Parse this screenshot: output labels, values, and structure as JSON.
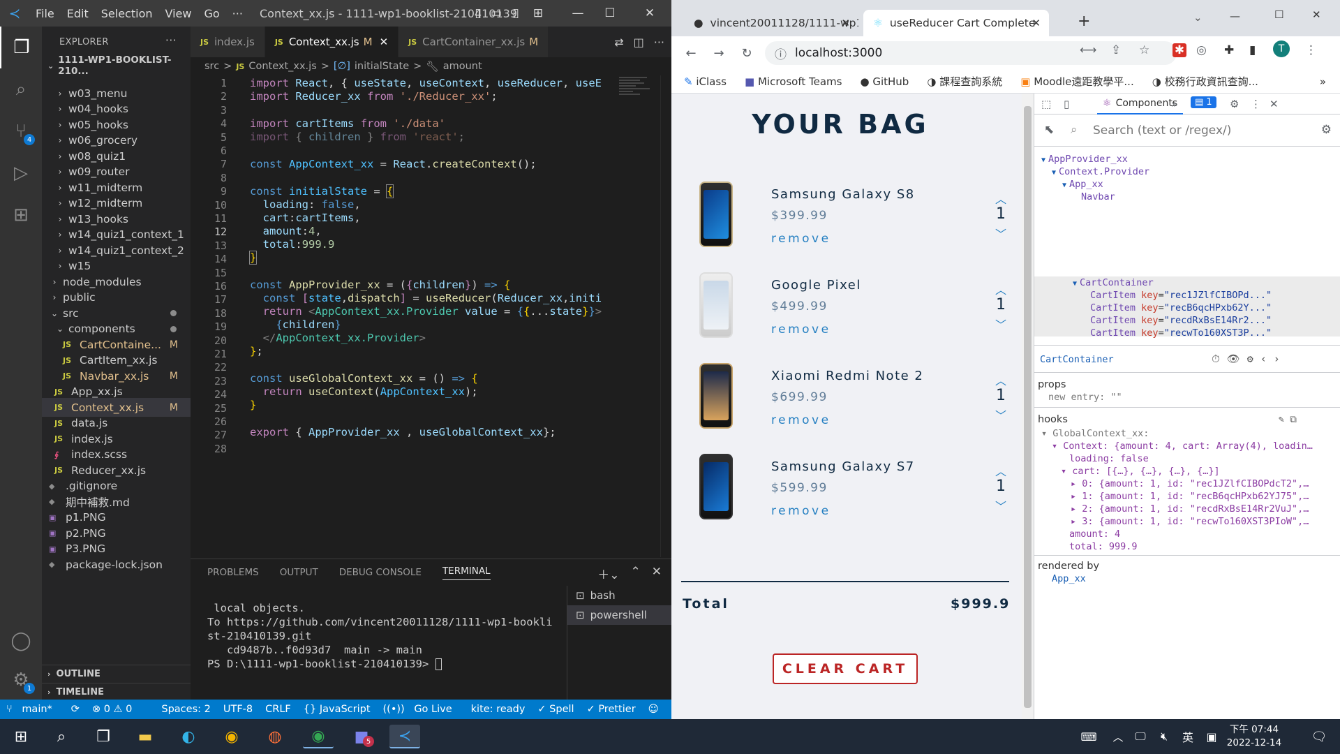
{
  "vscode": {
    "menu": [
      "File",
      "Edit",
      "Selection",
      "View",
      "Go",
      "···"
    ],
    "title": "Context_xx.js - 1111-wp1-booklist-210410139",
    "explorer_label": "EXPLORER",
    "root_folder": "1111-WP1-BOOKLIST-210...",
    "tree": [
      {
        "label": "w03_menu",
        "kind": "folder"
      },
      {
        "label": "w04_hooks",
        "kind": "folder"
      },
      {
        "label": "w05_hooks",
        "kind": "folder"
      },
      {
        "label": "w06_grocery",
        "kind": "folder"
      },
      {
        "label": "w08_quiz1",
        "kind": "folder"
      },
      {
        "label": "w09_router",
        "kind": "folder"
      },
      {
        "label": "w11_midterm",
        "kind": "folder"
      },
      {
        "label": "w12_midterm",
        "kind": "folder"
      },
      {
        "label": "w13_hooks",
        "kind": "folder"
      },
      {
        "label": "w14_quiz1_context_1",
        "kind": "folder"
      },
      {
        "label": "w14_quiz1_context_2",
        "kind": "folder"
      },
      {
        "label": "w15",
        "kind": "folder"
      },
      {
        "label": "node_modules",
        "kind": "folder"
      },
      {
        "label": "public",
        "kind": "folder"
      },
      {
        "label": "src",
        "kind": "folder-open"
      },
      {
        "label": "components",
        "kind": "folder-open"
      },
      {
        "label": "CartContaine...",
        "kind": "js",
        "badge": "M"
      },
      {
        "label": "CartItem_xx.js",
        "kind": "js"
      },
      {
        "label": "Navbar_xx.js",
        "kind": "js",
        "badge": "M"
      },
      {
        "label": "App_xx.js",
        "kind": "js"
      },
      {
        "label": "Context_xx.js",
        "kind": "js",
        "badge": "M"
      },
      {
        "label": "data.js",
        "kind": "js"
      },
      {
        "label": "index.js",
        "kind": "js"
      },
      {
        "label": "index.scss",
        "kind": "scss"
      },
      {
        "label": "Reducer_xx.js",
        "kind": "js"
      },
      {
        "label": ".gitignore",
        "kind": "file"
      },
      {
        "label": "期中補救.md",
        "kind": "file"
      },
      {
        "label": "p1.PNG",
        "kind": "img"
      },
      {
        "label": "p2.PNG",
        "kind": "img"
      },
      {
        "label": "P3.PNG",
        "kind": "img"
      },
      {
        "label": "package-lock.json",
        "kind": "file"
      }
    ],
    "outline_label": "OUTLINE",
    "timeline_label": "TIMELINE",
    "tabs": [
      {
        "label": "index.js",
        "modified": ""
      },
      {
        "label": "Context_xx.js",
        "modified": "M"
      },
      {
        "label": "CartContainer_xx.js",
        "modified": "M"
      }
    ],
    "breadcrumb": [
      "src",
      ">",
      "Context_xx.js",
      ">",
      "initialState",
      ">",
      "amount"
    ],
    "line_numbers": [
      "1",
      "2",
      "3",
      "4",
      "5",
      "6",
      "7",
      "8",
      "9",
      "10",
      "11",
      "12",
      "13",
      "14",
      "15",
      "16",
      "17",
      "18",
      "19",
      "20",
      "21",
      "22",
      "23",
      "24",
      "25",
      "26",
      "27",
      "28"
    ],
    "panel_tabs": [
      "PROBLEMS",
      "OUTPUT",
      "DEBUG CONSOLE",
      "TERMINAL"
    ],
    "terminal_lines": [
      " local objects.",
      "To https://github.com/vincent20011128/1111-wp1-bookli",
      "st-210410139.git",
      "   cd9487b..f0d93d7  main -> main",
      "PS D:\\1111-wp1-booklist-210410139> "
    ],
    "shells": [
      "bash",
      "powershell"
    ],
    "status": [
      "main*",
      "⟳",
      "⊗ 0 ⚠ 0",
      "Spaces: 2",
      "UTF-8",
      "CRLF",
      "{} JavaScript",
      "Go Live",
      "kite: ready",
      "✓ Spell",
      "✓ Prettier"
    ]
  },
  "chrome": {
    "tabs": [
      {
        "label": "vincent20011128/1111-wp1-b"
      },
      {
        "label": "useReducer Cart Complete"
      }
    ],
    "url": "localhost:3000",
    "profile_initial": "T",
    "bookmarks": [
      "iClass",
      "Microsoft Teams",
      "GitHub",
      "課程查詢系統",
      "Moodle遠距教學平...",
      "校務行政資訊查詢..."
    ],
    "page": {
      "heading": "YOUR BAG",
      "items": [
        {
          "name": "Samsung Galaxy S8",
          "price": "$399.99",
          "remove": "remove",
          "qty": "1"
        },
        {
          "name": "Google Pixel",
          "price": "$499.99",
          "remove": "remove",
          "qty": "1"
        },
        {
          "name": "Xiaomi Redmi Note 2",
          "price": "$699.99",
          "remove": "remove",
          "qty": "1"
        },
        {
          "name": "Samsung Galaxy S7",
          "price": "$599.99",
          "remove": "remove",
          "qty": "1"
        }
      ],
      "total_label": "Total",
      "total_value": "$999.9",
      "clear_label": "CLEAR CART"
    },
    "devtools": {
      "components_tab": "Components",
      "issues_count": "1",
      "search_placeholder": "Search (text or /regex/)",
      "tree": {
        "app_provider": "AppProvider_xx",
        "context_provider": "Context.Provider",
        "app": "App_xx",
        "navbar": "Navbar",
        "cart_container": "CartContainer",
        "cart_items": [
          {
            "name": "CartItem",
            "key": "key",
            "val": "\"rec1JZlfCIBOPd...\""
          },
          {
            "name": "CartItem",
            "key": "key",
            "val": "\"recB6qcHPxb62Y...\""
          },
          {
            "name": "CartItem",
            "key": "key",
            "val": "\"recdRxBsE14Rr2...\""
          },
          {
            "name": "CartItem",
            "key": "key",
            "val": "\"recwTo160XST3P...\""
          }
        ]
      },
      "selected": "CartContainer",
      "props_label": "props",
      "props_entry": "new entry: \"\"",
      "hooks_label": "hooks",
      "hooks": {
        "global": "GlobalContext_xx:",
        "context": "Context: {amount: 4, cart: Array(4), loadin…",
        "loading": "loading: false",
        "cart": "cart: [{…}, {…}, {…}, {…}]",
        "c0": "0: {amount: 1, id: \"rec1JZlfCIBOPdcT2\",…",
        "c1": "1: {amount: 1, id: \"recB6qcHPxb62YJ75\",…",
        "c2": "2: {amount: 1, id: \"recdRxBsE14Rr2VuJ\",…",
        "c3": "3: {amount: 1, id: \"recwTo160XST3PIoW\",…",
        "amount": "amount: 4",
        "total": "total: 999.9"
      },
      "rendered_by_label": "rendered by",
      "rendered_by": "App_xx"
    }
  },
  "taskbar": {
    "time": "下午 07:44",
    "date": "2022-12-14",
    "ime": "英",
    "teams_badge": "5"
  }
}
